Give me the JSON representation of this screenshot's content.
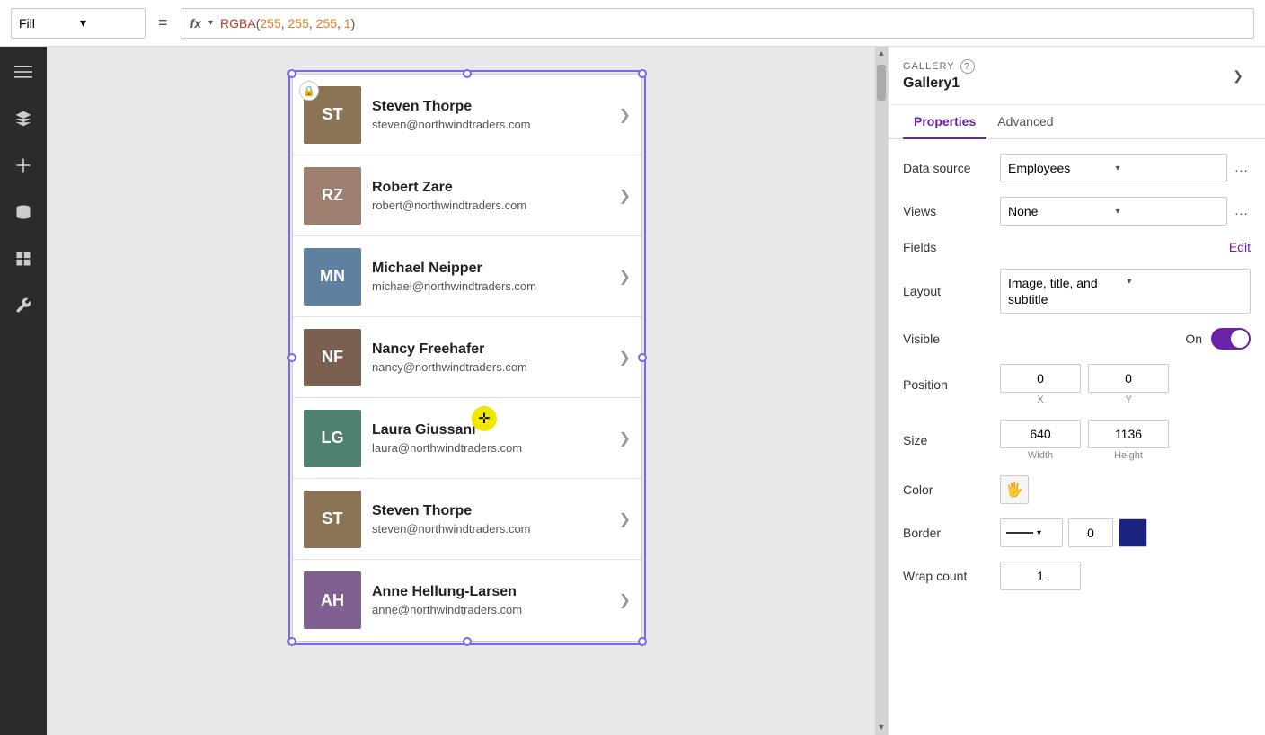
{
  "toolbar": {
    "fill_label": "Fill",
    "equals": "=",
    "fx_label": "fx",
    "formula": "RGBA(255, 255, 255, 1)"
  },
  "sidebar": {
    "icons": [
      "menu",
      "layers",
      "add",
      "database",
      "component",
      "tools"
    ]
  },
  "gallery": {
    "items": [
      {
        "name": "Steven Thorpe",
        "email": "steven@northwindtraders.com",
        "bg": "#7a6a5a",
        "initials": "ST"
      },
      {
        "name": "Robert Zare",
        "email": "robert@northwindtraders.com",
        "bg": "#8a7060",
        "initials": "RZ"
      },
      {
        "name": "Michael Neipper",
        "email": "michael@northwindtraders.com",
        "bg": "#5a6a7a",
        "initials": "MN"
      },
      {
        "name": "Nancy Freehafer",
        "email": "nancy@northwindtraders.com",
        "bg": "#6a5a4a",
        "initials": "NF"
      },
      {
        "name": "Laura Giussani",
        "email": "laura@northwindtraders.com",
        "bg": "#4a7a6a",
        "initials": "LG"
      },
      {
        "name": "Steven Thorpe",
        "email": "steven@northwindtraders.com",
        "bg": "#7a6a5a",
        "initials": "ST"
      },
      {
        "name": "Anne Hellung-Larsen",
        "email": "anne@northwindtraders.com",
        "bg": "#6a5a7a",
        "initials": "AH"
      }
    ]
  },
  "right_panel": {
    "section_label": "GALLERY",
    "help_icon": "?",
    "gallery_name": "Gallery1",
    "nav_arrow": "❯",
    "tabs": [
      "Properties",
      "Advanced"
    ],
    "active_tab": "Properties",
    "properties": {
      "data_source_label": "Data source",
      "data_source_value": "Employees",
      "views_label": "Views",
      "views_value": "None",
      "fields_label": "Fields",
      "fields_edit": "Edit",
      "layout_label": "Layout",
      "layout_value": "Image, title, and subtitle",
      "visible_label": "Visible",
      "visible_on": "On",
      "position_label": "Position",
      "pos_x": "0",
      "pos_y": "0",
      "x_label": "X",
      "y_label": "Y",
      "size_label": "Size",
      "width": "640",
      "height": "1136",
      "width_label": "Width",
      "height_label": "Height",
      "color_label": "Color",
      "border_label": "Border",
      "border_num": "0",
      "wrap_count_label": "Wrap count",
      "wrap_count_value": "1"
    }
  }
}
